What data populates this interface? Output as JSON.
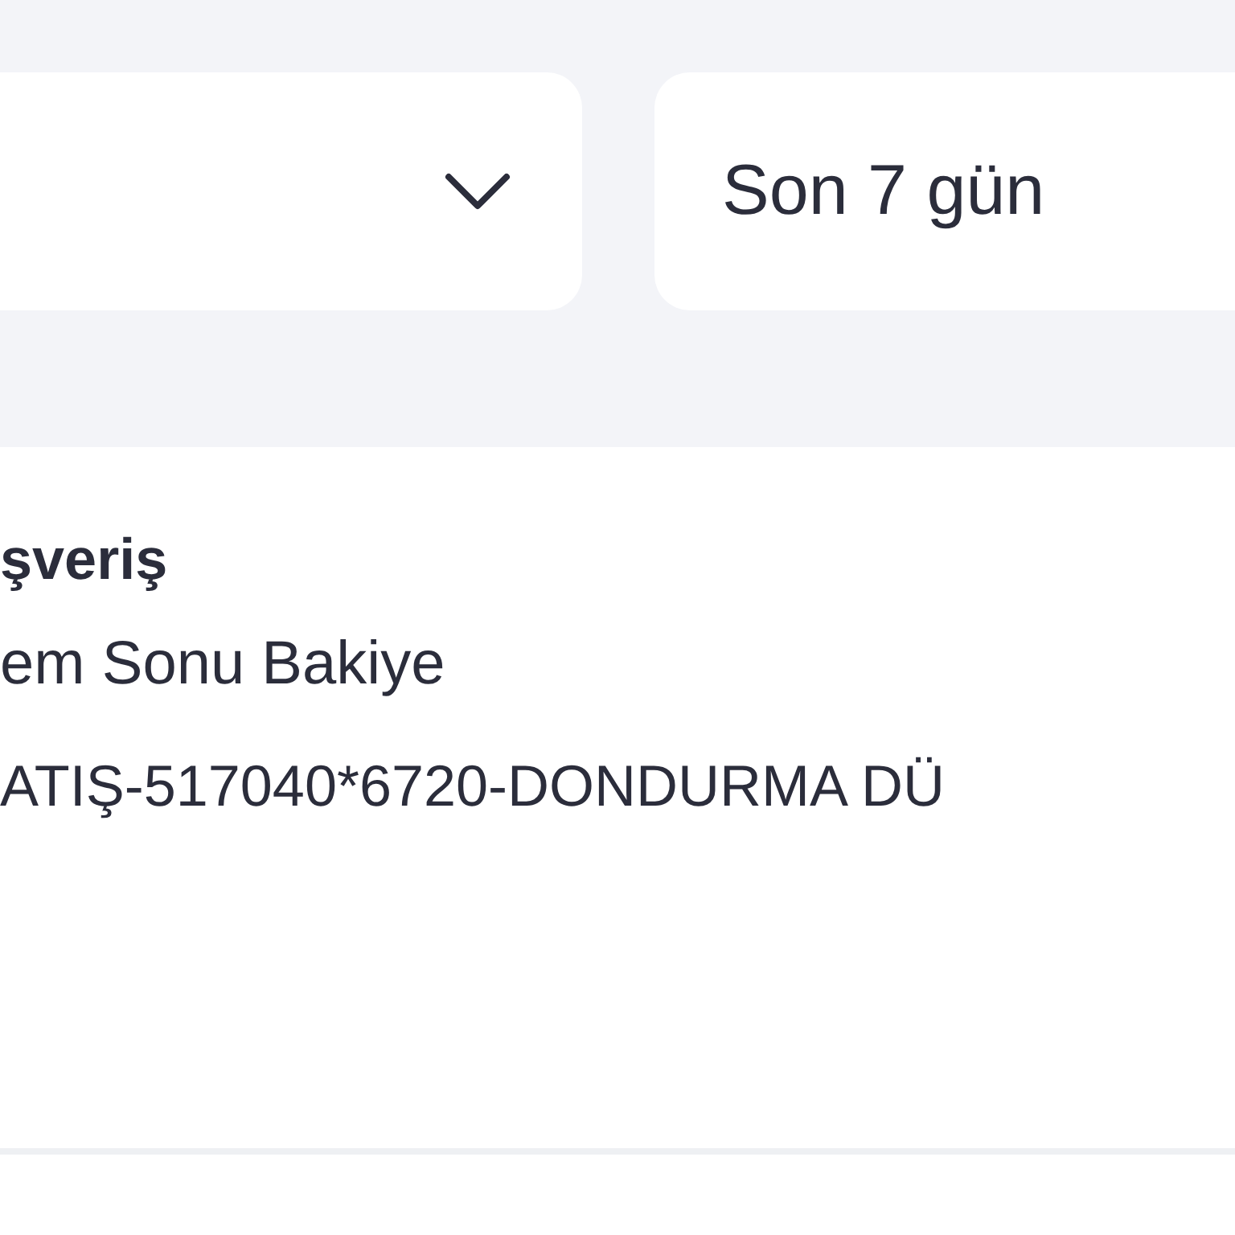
{
  "filters": [
    {
      "kind": "dropdown"
    },
    {
      "kind": "period",
      "label": "Son 7 gün"
    }
  ],
  "transaction": {
    "title": "şveriş",
    "subtitle": "em Sonu Bakiye",
    "description": "ATIŞ-517040*6720-DONDURMA DÜ"
  }
}
